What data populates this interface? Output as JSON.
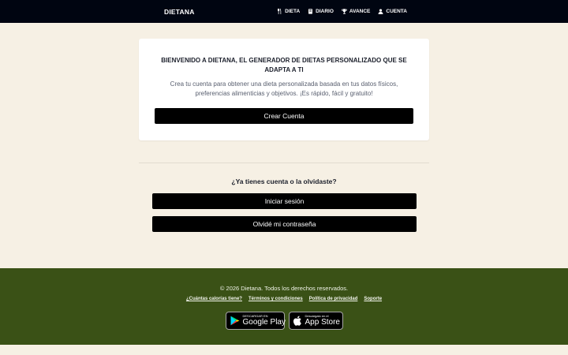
{
  "header": {
    "brand": "DIETANA",
    "nav": [
      {
        "label": "DIETA",
        "icon": "utensils-icon"
      },
      {
        "label": "DIARIO",
        "icon": "book-icon"
      },
      {
        "label": "AVANCE",
        "icon": "trophy-icon"
      },
      {
        "label": "CUENTA",
        "icon": "user-icon"
      }
    ]
  },
  "welcome": {
    "title": "BIENVENIDO A DIETANA, EL GENERADOR DE DIETAS PERSONALIZADO QUE SE ADAPTA A TI",
    "text": "Crea tu cuenta para obtener una dieta personalizada basada en tus datos físicos, preferencias alimenticias y objetivos. ¡Es rápido, fácil y gratuito!",
    "create_label": "Crear Cuenta"
  },
  "login": {
    "question": "¿Ya tienes cuenta o la olvidaste?",
    "login_label": "Iniciar sesión",
    "forgot_label": "Olvidé mi contraseña"
  },
  "footer": {
    "copyright": "© 2026 Dietana. Todos los derechos reservados.",
    "links": [
      "¿Cuántas calorías tiene?",
      "Términos y condiciones",
      "Política de privacidad",
      "Soporte"
    ],
    "google_play": {
      "small": "DESCARGAR EN",
      "big": "Google Play"
    },
    "app_store": {
      "small": "Descárgalo en el",
      "big": "App Store"
    }
  },
  "colors": {
    "header_bg": "#000511",
    "page_bg": "#f6f0e4",
    "footer_bg": "#3a5116",
    "button_bg": "#000000"
  }
}
